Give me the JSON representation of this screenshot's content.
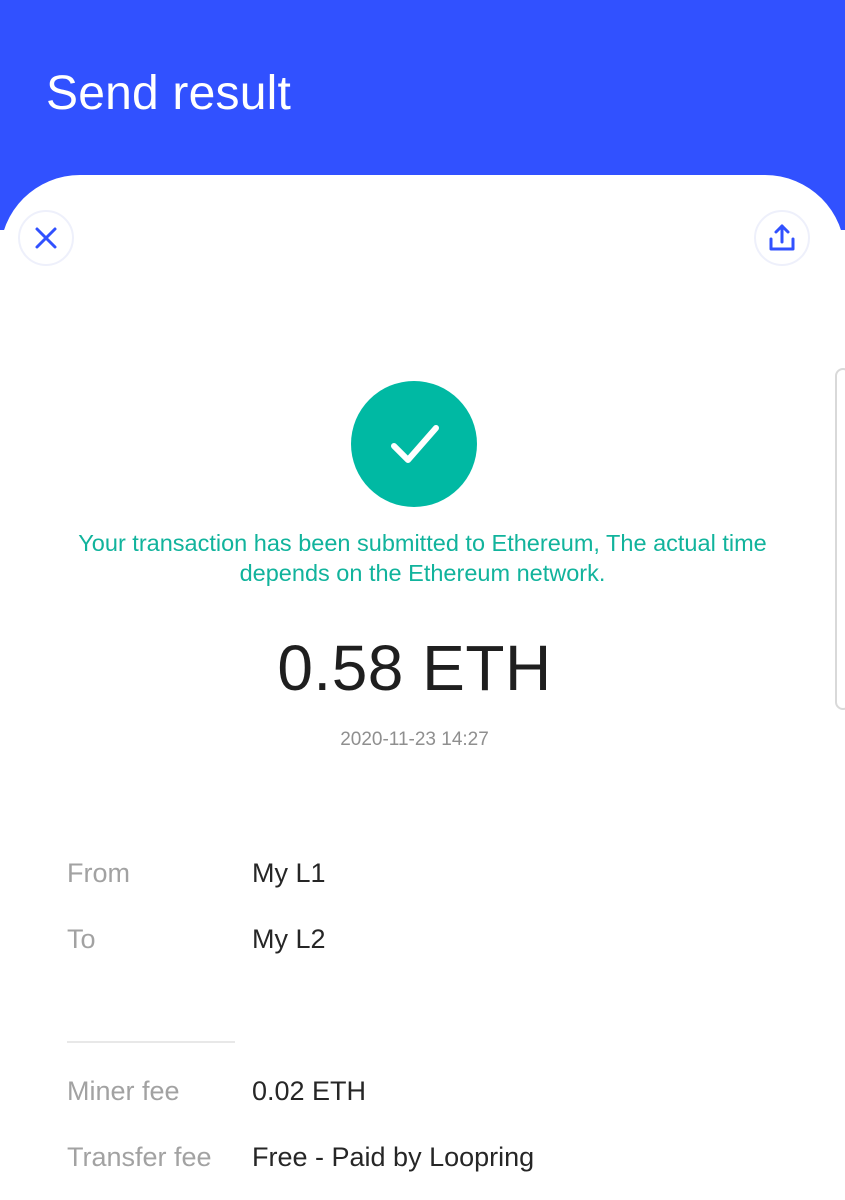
{
  "header": {
    "title": "Send result",
    "background_color": "#3151ff"
  },
  "actions": {
    "close_icon": "close-icon",
    "share_icon": "share-icon"
  },
  "status": {
    "icon": "check-icon",
    "color": "#00b9a3",
    "message": "Your transaction has been submitted to Ethereum, The actual time depends on the Ethereum network."
  },
  "transaction": {
    "amount": "0.58 ETH",
    "timestamp": "2020-11-23 14:27"
  },
  "details": {
    "from_label": "From",
    "from_value": "My L1",
    "to_label": "To",
    "to_value": "My L2",
    "miner_fee_label": "Miner fee",
    "miner_fee_value": "0.02 ETH",
    "transfer_fee_label": "Transfer fee",
    "transfer_fee_value": "Free - Paid by Loopring"
  }
}
